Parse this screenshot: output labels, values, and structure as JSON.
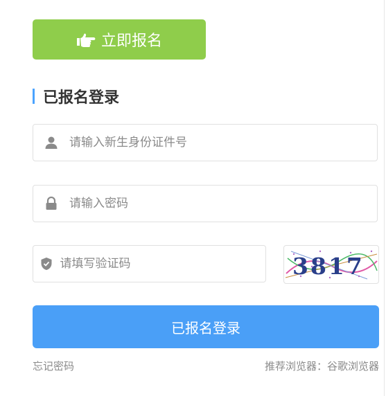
{
  "register": {
    "label": "立即报名"
  },
  "section": {
    "title": "已报名登录"
  },
  "fields": {
    "id_number": {
      "placeholder": "请输入新生身份证件号",
      "value": ""
    },
    "password": {
      "placeholder": "请输入密码",
      "value": ""
    },
    "captcha": {
      "placeholder": "请填写验证码",
      "value": ""
    }
  },
  "captcha_image": {
    "text": "3817"
  },
  "login": {
    "label": "已报名登录"
  },
  "footer": {
    "forgot_label": "忘记密码",
    "browser_tip": "推荐浏览器：谷歌浏览器"
  },
  "icons": {
    "register": "hand-pointing-right-icon",
    "id_number": "user-icon",
    "password": "lock-icon",
    "captcha": "shield-check-icon"
  },
  "colors": {
    "register_bg": "#8fcd4b",
    "accent": "#4aa3ff",
    "login_bg": "#4a9ff7"
  }
}
